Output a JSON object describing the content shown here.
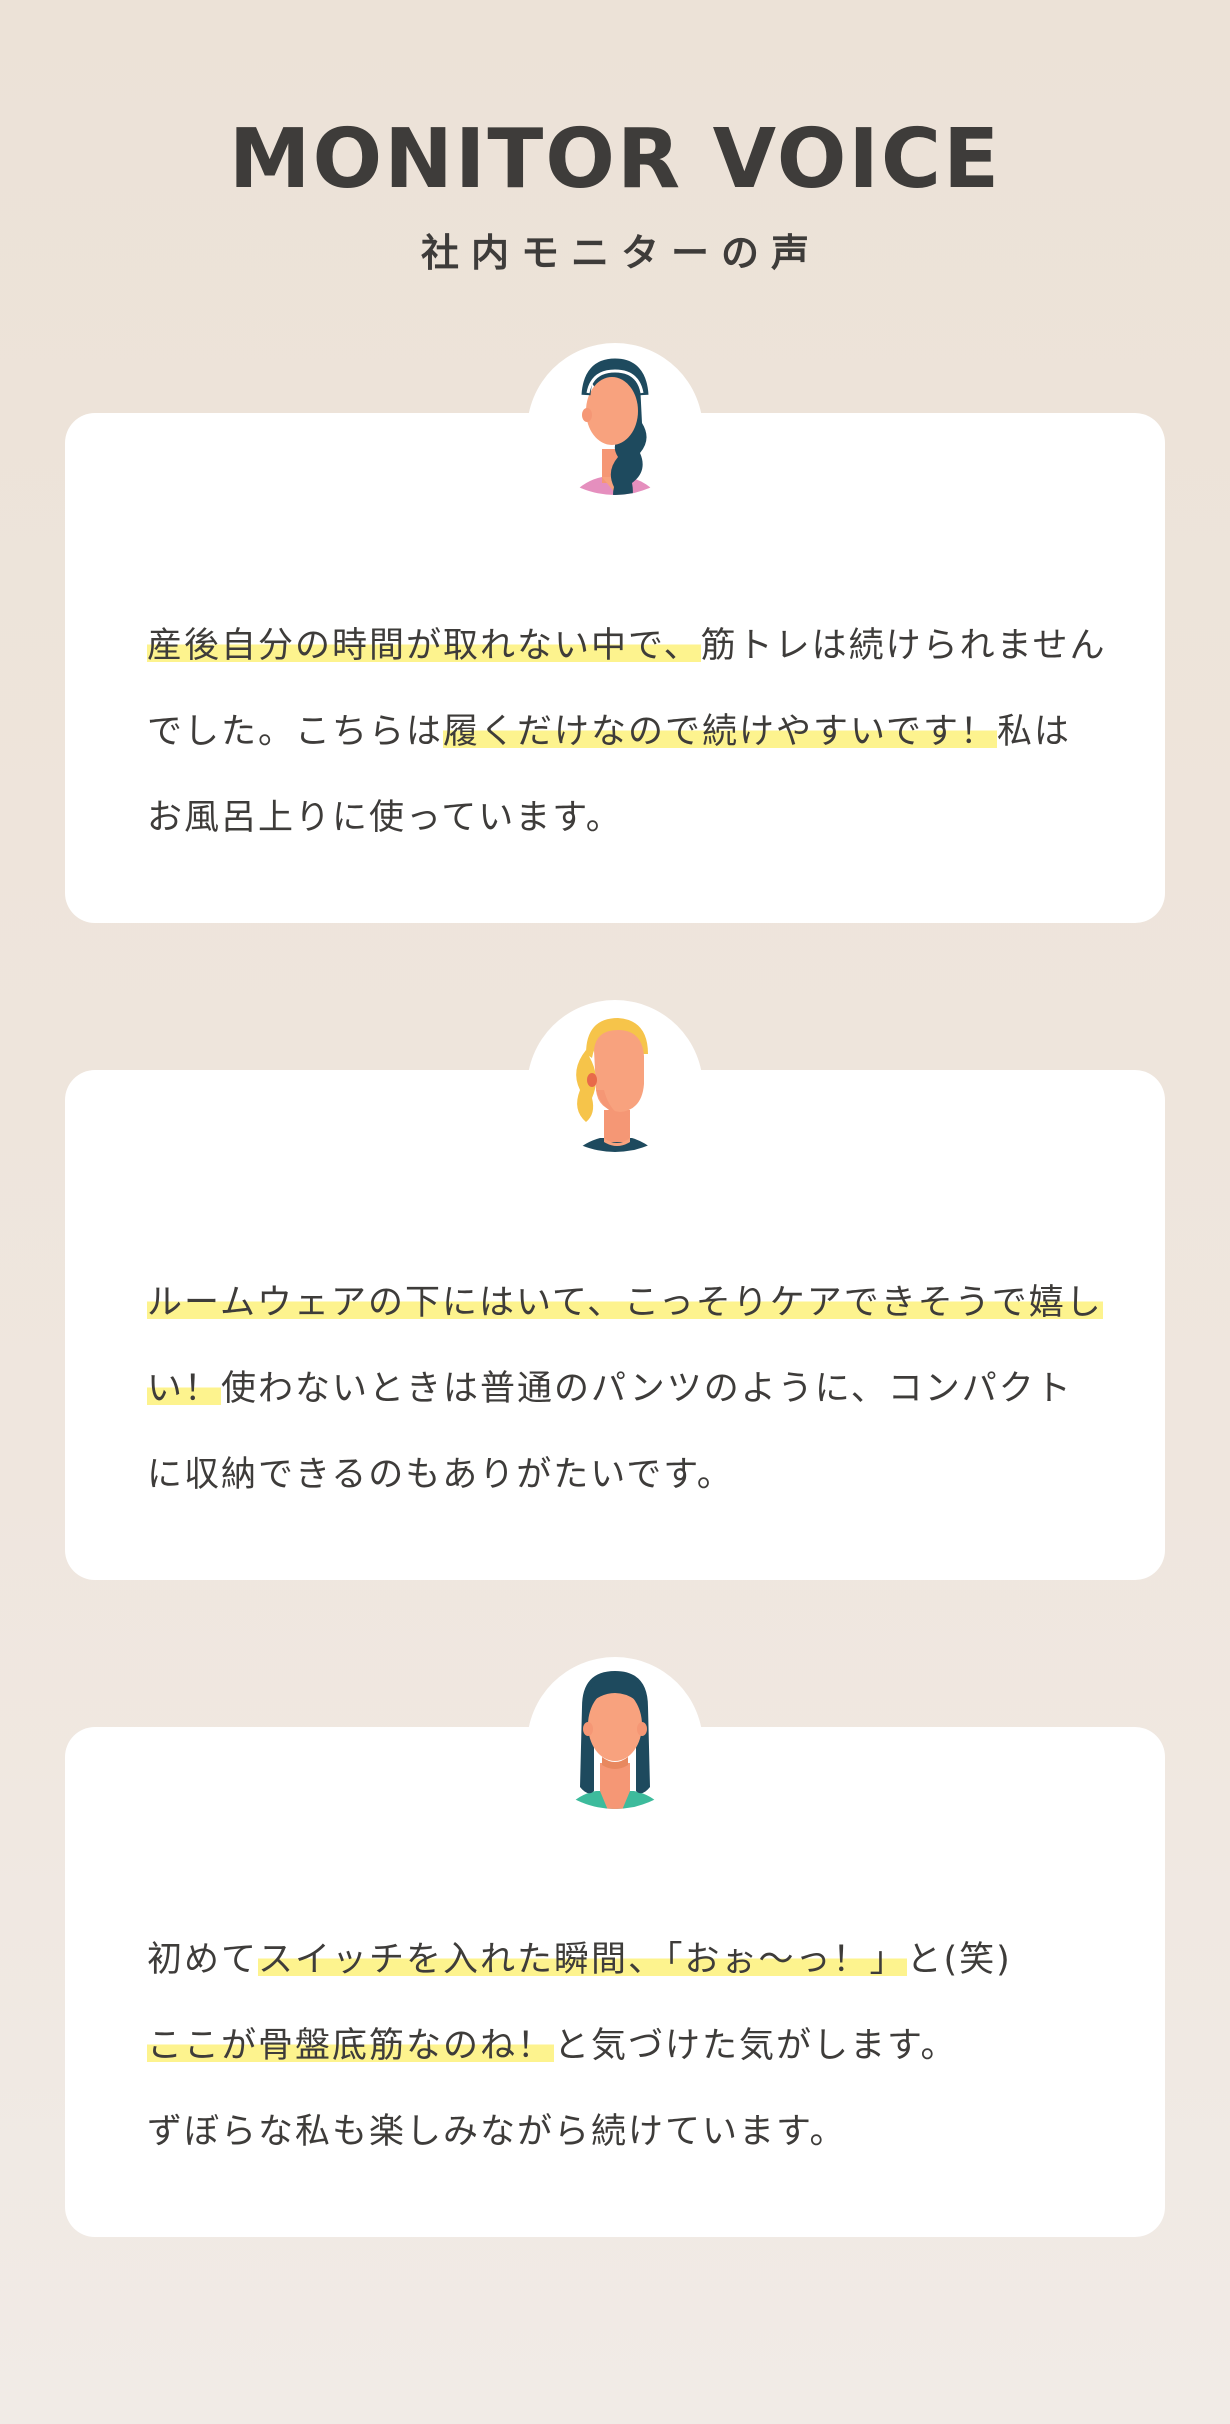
{
  "header": {
    "title": "MONITOR VOICE",
    "subtitle": "社内モニターの声"
  },
  "colors": {
    "background": "#ece2d7",
    "card": "#ffffff",
    "highlight": "#fdf38e",
    "text": "#3e3c3a",
    "skin": "#f8a27e",
    "hair_navy": "#1e4a5e",
    "hair_yellow": "#f6c44a",
    "shirt_pink": "#e58fbe",
    "shirt_navy": "#1e4a5e",
    "shirt_teal": "#3dbb9c"
  },
  "testimonials": [
    {
      "avatar": "woman-headband-wavy-hair-avatar-icon",
      "segments": [
        {
          "text": "産後自分の時間が取れない中で、",
          "highlight": true
        },
        {
          "text": "筋トレは続けられませんでした。こちらは",
          "highlight": false
        },
        {
          "text": "履くだけなので続けやすいです！",
          "highlight": true
        },
        {
          "text": "私はお風呂上りに使っています。",
          "highlight": false
        }
      ]
    },
    {
      "avatar": "woman-blonde-ponytail-avatar-icon",
      "segments": [
        {
          "text": "ルームウェアの下にはいて、こっそりケアできそうで嬉しい！",
          "highlight": true
        },
        {
          "text": "使わないときは普通のパンツのように、コンパクトに収納できるのもありがたいです。",
          "highlight": false
        }
      ]
    },
    {
      "avatar": "woman-long-dark-hair-avatar-icon",
      "segments": [
        {
          "text": "初めて",
          "highlight": false
        },
        {
          "text": "スイッチを入れた瞬間、「おぉ〜っ！」",
          "highlight": true
        },
        {
          "text": "と(笑)",
          "highlight": false
        },
        {
          "text": "ここが骨盤底筋なのね！",
          "highlight": true
        },
        {
          "text": "と気づけた気がします。",
          "highlight": false
        },
        {
          "text": "ずぼらな私も楽しみながら続けています。",
          "highlight": false
        }
      ]
    }
  ]
}
